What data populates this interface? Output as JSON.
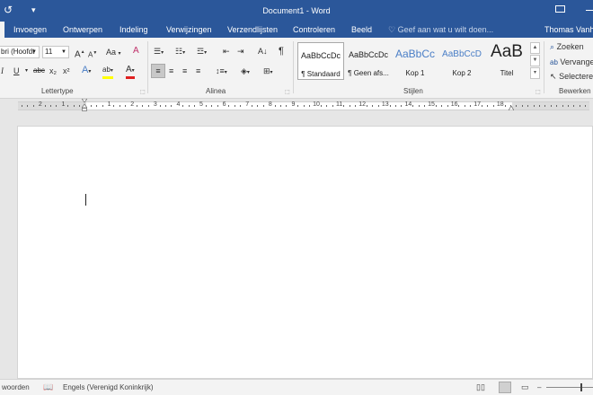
{
  "titlebar": {
    "title": "Document1 - Word",
    "undo_icon": "↺",
    "qa_more": "▾"
  },
  "tabs": {
    "invoegen": "Invoegen",
    "ontwerpen": "Ontwerpen",
    "indeling": "Indeling",
    "verwijzingen": "Verwijzingen",
    "verzendlijsten": "Verzendlijsten",
    "controleren": "Controleren",
    "beeld": "Beeld"
  },
  "tell_me": {
    "icon": "♡",
    "text": "Geef aan wat u wilt doen..."
  },
  "user": "Thomas Vanhoe",
  "font": {
    "name": "bri (Hoofdt",
    "size": "11",
    "grow": "A",
    "shrink": "A",
    "case": "Aa",
    "clear": "A",
    "italic": "I",
    "underline": "U",
    "strike": "abc",
    "subscript": "x₂",
    "superscript": "x²",
    "effects": "A",
    "highlight": "ab",
    "color": "A",
    "label": "Lettertype"
  },
  "paragraph": {
    "label": "Alinea",
    "sort": "A↓",
    "marks": "¶"
  },
  "styles": {
    "label": "Stijlen",
    "items": [
      {
        "sample": "AaBbCcDc",
        "name": "¶ Standaard"
      },
      {
        "sample": "AaBbCcDc",
        "name": "¶ Geen afs..."
      },
      {
        "sample": "AaBbCc",
        "name": "Kop 1"
      },
      {
        "sample": "AaBbCcD",
        "name": "Kop 2"
      },
      {
        "sample": "AaB",
        "name": "Titel"
      }
    ]
  },
  "editing": {
    "label": "Bewerken",
    "find": "Zoeken",
    "replace": "Vervangen",
    "select": "Selecteren"
  },
  "ruler": {
    "numbers": [
      "2",
      "1",
      "1",
      "2",
      "3",
      "4",
      "5",
      "6",
      "7",
      "8",
      "9",
      "10",
      "11",
      "12",
      "13",
      "14",
      "15",
      "16",
      "17",
      "18"
    ]
  },
  "status": {
    "words": "woorden",
    "language": "Engels (Verenigd Koninkrijk)"
  },
  "colors": {
    "accent": "#2b579a",
    "highlight": "#ffff00",
    "font_color": "#e02020"
  }
}
